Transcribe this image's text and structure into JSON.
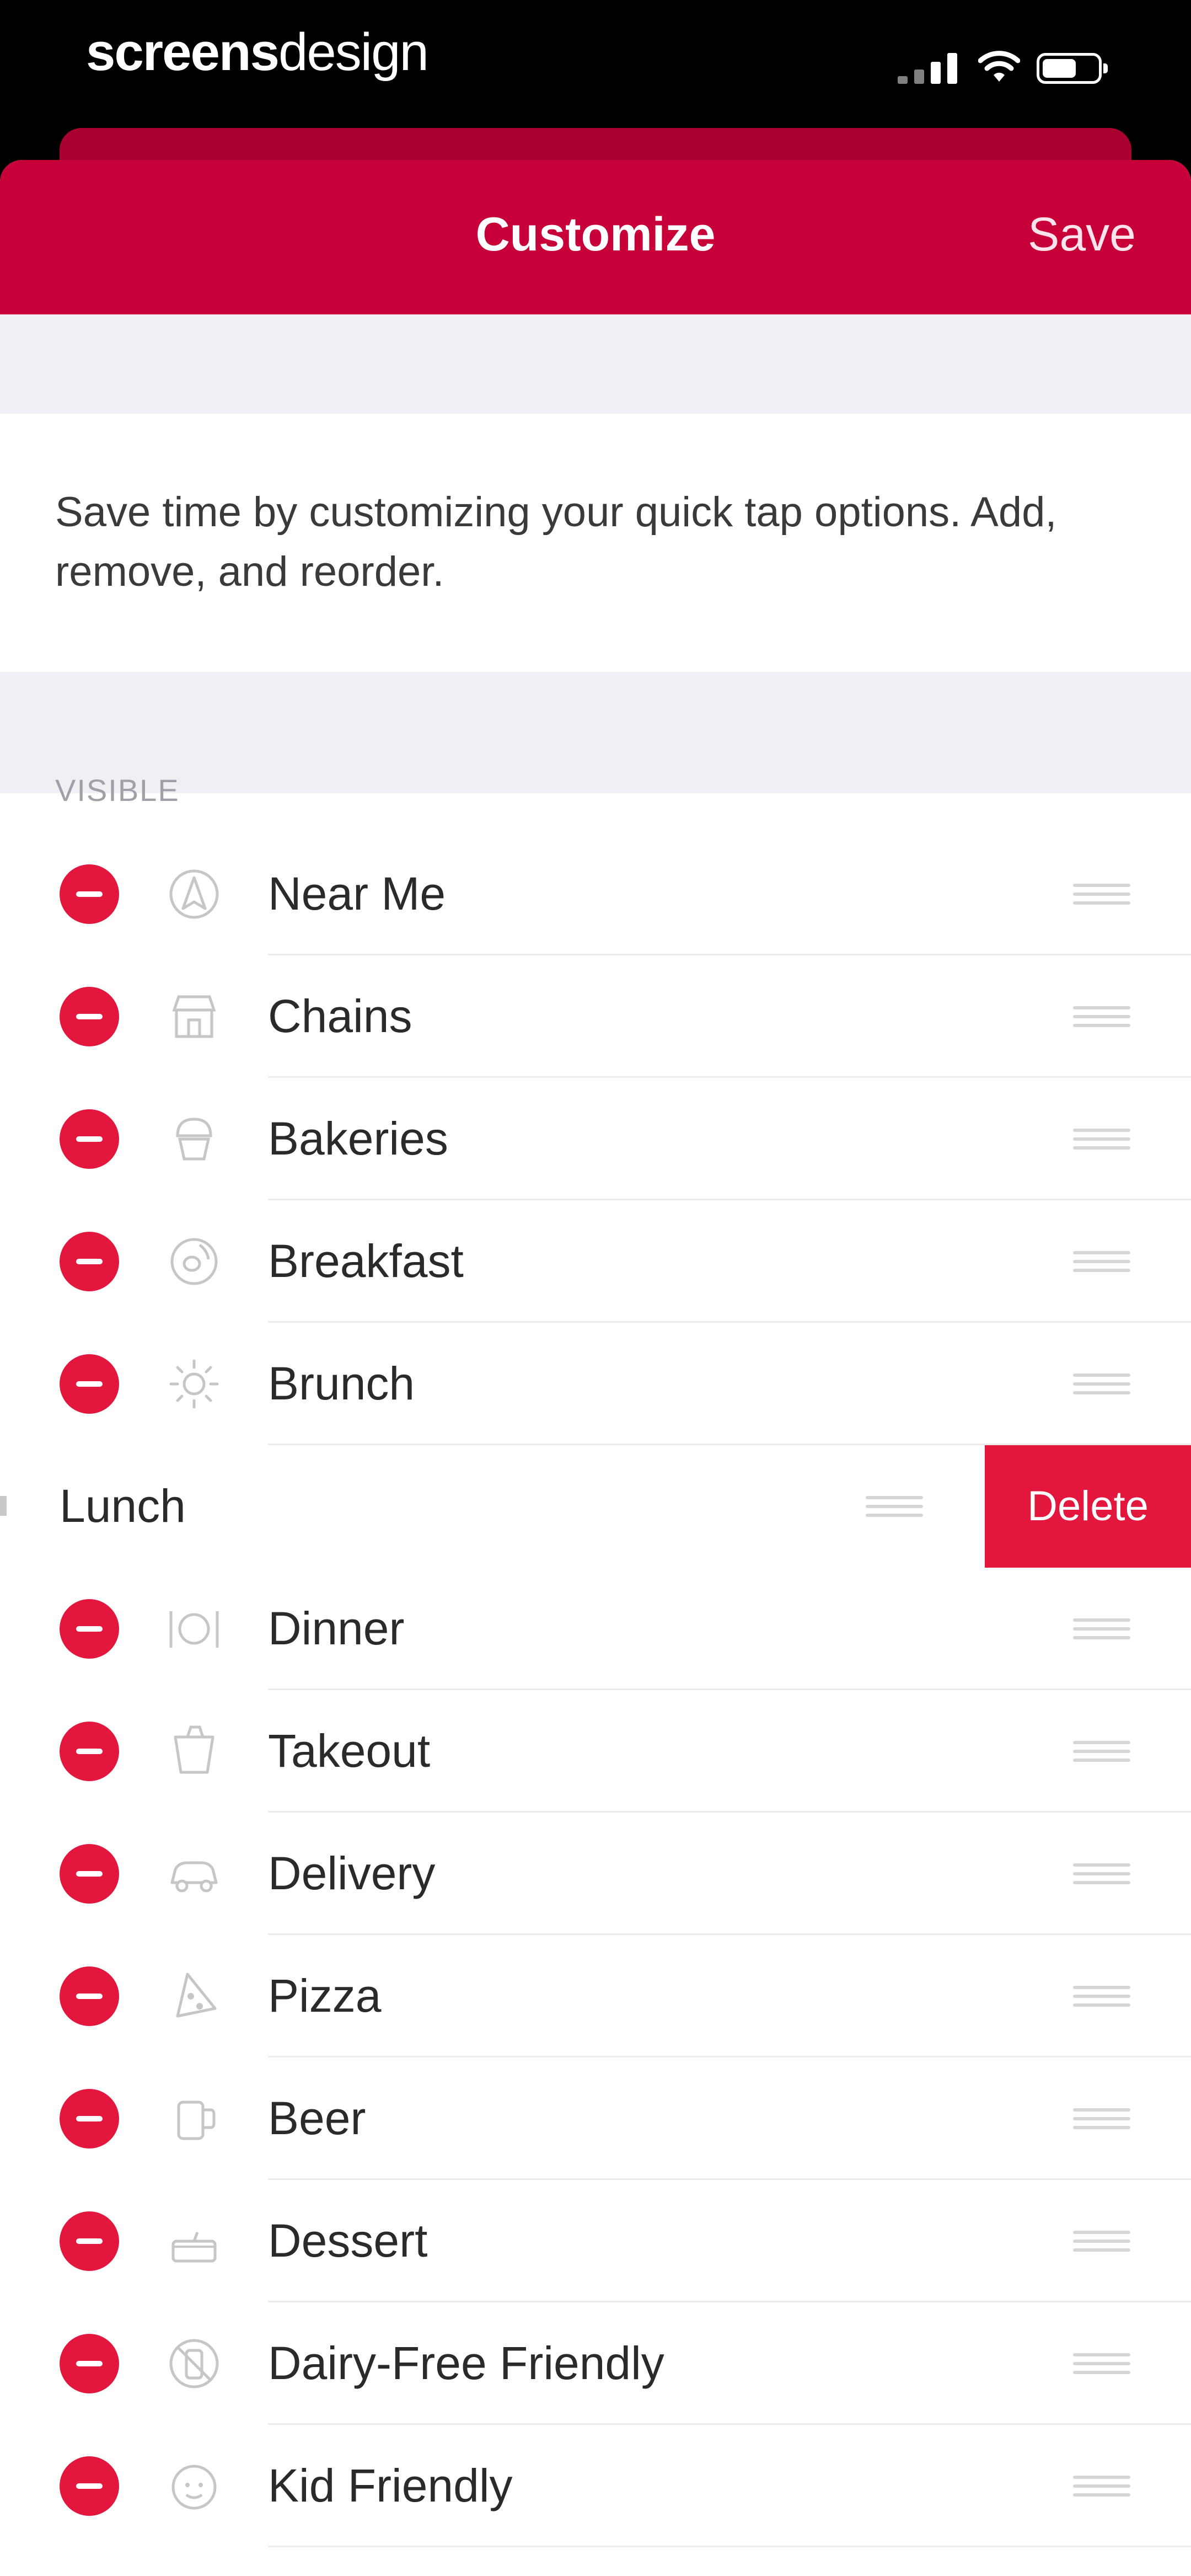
{
  "status_bar": {
    "watermark_bold": "screens",
    "watermark_light": "design",
    "signal_icon": "cellular-signal-icon",
    "wifi_icon": "wifi-icon",
    "battery_icon": "battery-icon"
  },
  "nav": {
    "title": "Customize",
    "save_label": "Save"
  },
  "intro_text": "Save time by customizing your quick tap options. Add, remove, and reorder.",
  "section_header": "VISIBLE",
  "items": [
    {
      "label": "Near Me",
      "icon": "location-arrow-icon"
    },
    {
      "label": "Chains",
      "icon": "storefront-icon"
    },
    {
      "label": "Bakeries",
      "icon": "cupcake-icon"
    },
    {
      "label": "Breakfast",
      "icon": "egg-icon"
    },
    {
      "label": "Brunch",
      "icon": "sun-icon"
    },
    {
      "label": "Lunch",
      "icon": "",
      "swiped": true,
      "delete_label": "Delete"
    },
    {
      "label": "Dinner",
      "icon": "fork-plate-knife-icon"
    },
    {
      "label": "Takeout",
      "icon": "takeout-box-icon"
    },
    {
      "label": "Delivery",
      "icon": "delivery-car-icon"
    },
    {
      "label": "Pizza",
      "icon": "pizza-slice-icon"
    },
    {
      "label": "Beer",
      "icon": "beer-mug-icon"
    },
    {
      "label": "Dessert",
      "icon": "cake-icon"
    },
    {
      "label": "Dairy-Free Friendly",
      "icon": "dairy-free-icon"
    },
    {
      "label": "Kid Friendly",
      "icon": "kid-face-icon"
    }
  ],
  "colors": {
    "brand": "#c8003a",
    "delete": "#e3173e",
    "background": "#efeff4"
  }
}
